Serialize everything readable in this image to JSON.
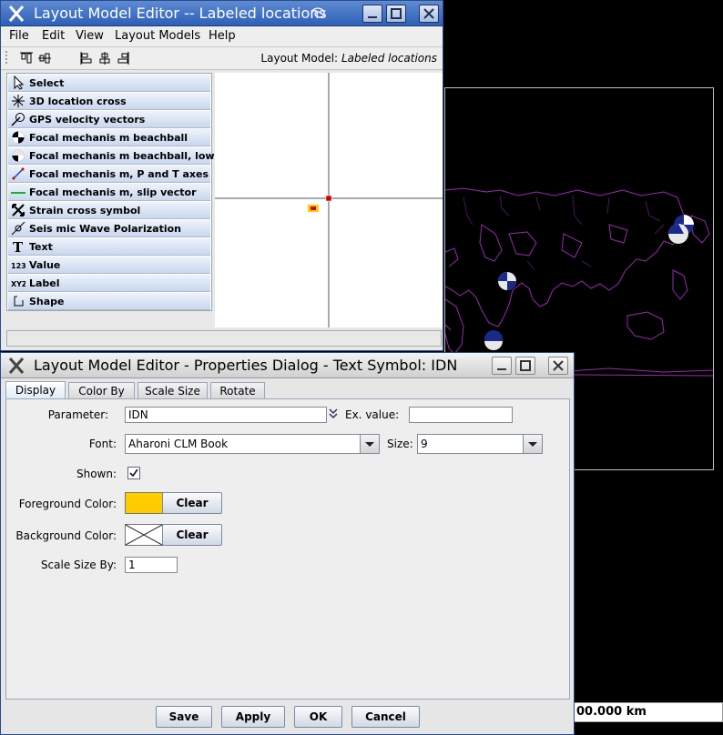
{
  "editor": {
    "title": "Layout Model Editor -- Labeled locations",
    "menu": [
      "File",
      "Edit",
      "View",
      "Layout Models",
      "Help"
    ],
    "layout_model_prefix": "Layout Model:",
    "layout_model_name": "Labeled locations",
    "tools": [
      {
        "label": "Select",
        "icon": "arrow-pointer-icon"
      },
      {
        "label": "3D location cross",
        "icon": "asterisk-cross-icon"
      },
      {
        "label": "GPS velocity vectors",
        "icon": "velocity-vector-icon"
      },
      {
        "label": "Focal mechanis m beachball",
        "icon": "beachball-icon"
      },
      {
        "label": "Focal mechanis m beachball, lower half",
        "icon": "beachball-lower-half-icon"
      },
      {
        "label": "Focal mechanis m, P and T axes",
        "icon": "pt-axes-icon"
      },
      {
        "label": "Focal mechanis m, slip vector",
        "icon": "slip-vector-icon"
      },
      {
        "label": "Strain cross symbol",
        "icon": "strain-cross-icon"
      },
      {
        "label": "Seis mic Wave Polarization",
        "icon": "wave-polarization-icon"
      },
      {
        "label": "Text",
        "icon": "text-t-icon"
      },
      {
        "label": "Value",
        "icon": "value-123-icon"
      },
      {
        "label": "Label",
        "icon": "label-xyz-icon"
      },
      {
        "label": "Shape",
        "icon": "shape-icon"
      }
    ]
  },
  "map": {
    "scale_text": "00.000 km",
    "colors": {
      "coastline": "#9a2bb0",
      "beachball": "#1a2a8a"
    }
  },
  "dialog": {
    "title": "Layout Model Editor - Properties Dialog - Text Symbol: IDN",
    "tabs": [
      "Display",
      "Color By",
      "Scale Size",
      "Rotate"
    ],
    "active_tab": "Display",
    "parameter_label": "Parameter:",
    "parameter_value": "IDN",
    "exvalue_label": "Ex. value:",
    "exvalue_value": "",
    "font_label": "Font:",
    "font_value": "Aharoni CLM Book",
    "size_label": "Size:",
    "size_value": "9",
    "shown_label": "Shown:",
    "shown_checked": true,
    "fg_label": "Foreground Color:",
    "fg_color": "#ffcc00",
    "bg_label": "Background Color:",
    "clear_label": "Clear",
    "scale_label": "Scale Size By:",
    "scale_value": "1",
    "buttons": {
      "save": "Save",
      "apply": "Apply",
      "ok": "OK",
      "cancel": "Cancel"
    }
  }
}
